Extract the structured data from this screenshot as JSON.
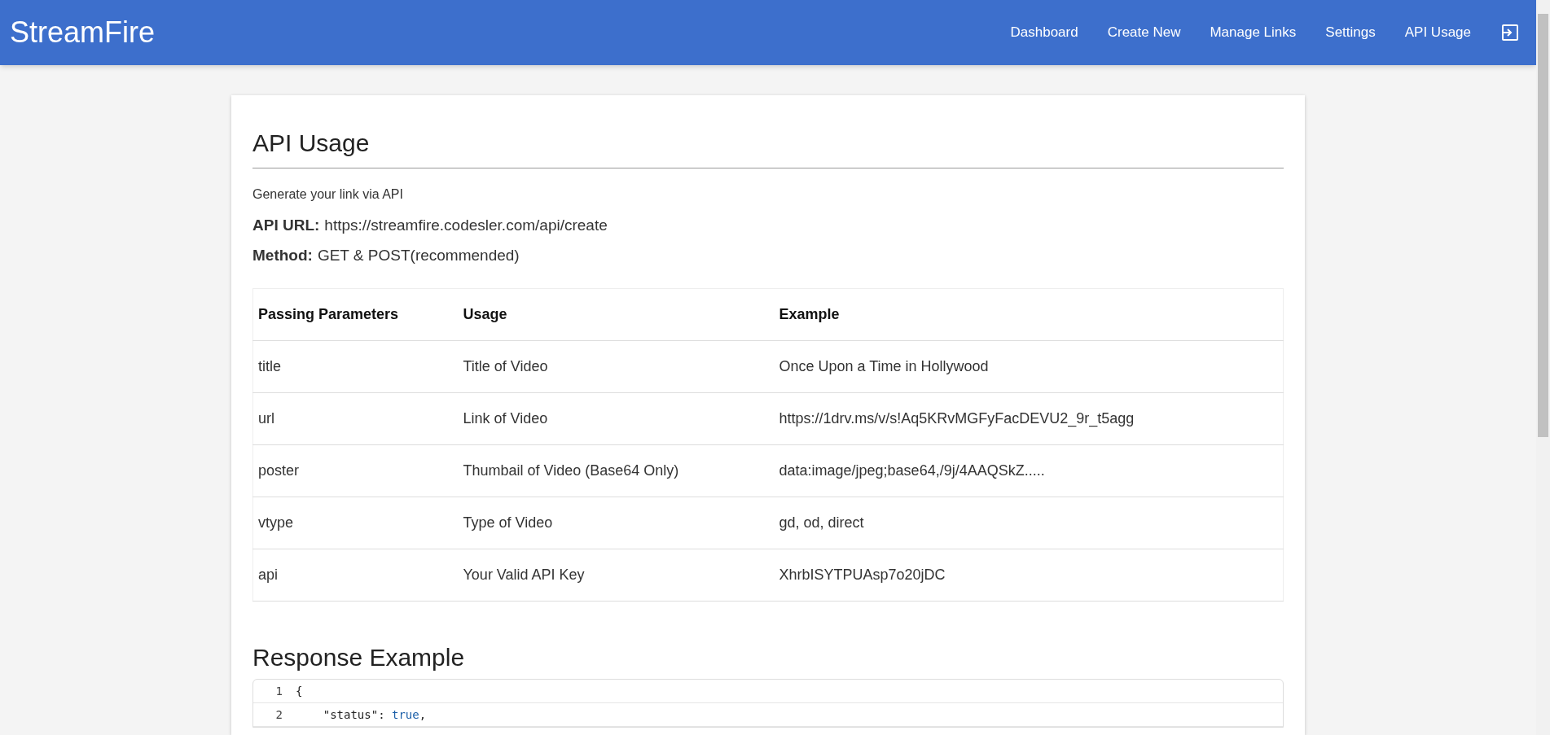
{
  "navbar": {
    "brand": "StreamFire",
    "links": [
      {
        "label": "Dashboard"
      },
      {
        "label": "Create New"
      },
      {
        "label": "Manage Links"
      },
      {
        "label": "Settings"
      },
      {
        "label": "API Usage"
      }
    ]
  },
  "card": {
    "title": "API Usage",
    "subtitle": "Generate your link via API",
    "details": [
      {
        "label": "API URL:",
        "value": "https://streamfire.codesler.com/api/create"
      },
      {
        "label": "Method:",
        "value": "GET & POST(recommended)"
      }
    ],
    "table": {
      "columns": [
        "Passing Parameters",
        "Usage",
        "Example"
      ],
      "rows": [
        [
          "title",
          "Title of Video",
          "Once Upon a Time in Hollywood"
        ],
        [
          "url",
          "Link of Video",
          "https://1drv.ms/v/s!Aq5KRvMGFyFacDEVU2_9r_t5agg"
        ],
        [
          "poster",
          "Thumbail of Video (Base64 Only)",
          "data:image/jpeg;base64,/9j/4AAQSkZ....."
        ],
        [
          "vtype",
          "Type of Video",
          "gd, od, direct"
        ],
        [
          "api",
          "Your Valid API Key",
          "XhrbISYTPUAsp7o20jDC"
        ]
      ]
    },
    "response_title": "Response Example",
    "code": [
      {
        "number": "1",
        "tokens": [
          {
            "kind": "punct",
            "text": "{"
          }
        ]
      },
      {
        "number": "2",
        "tokens": [
          {
            "kind": "punct",
            "text": "    \"status\": "
          },
          {
            "kind": "keyword",
            "text": "true"
          },
          {
            "kind": "punct",
            "text": ","
          }
        ]
      }
    ]
  }
}
